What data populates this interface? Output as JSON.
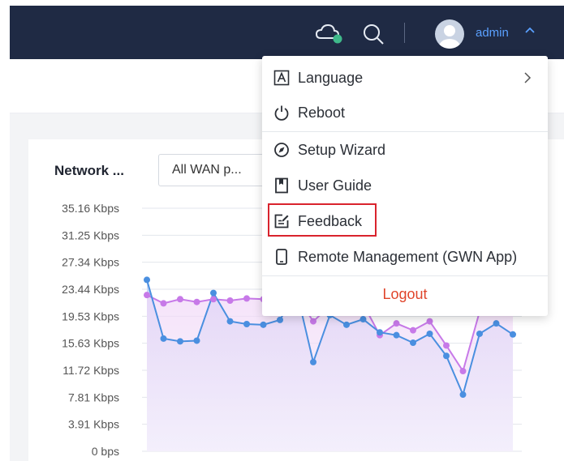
{
  "header": {
    "cloud_icon": "cloud-status-icon",
    "search_icon": "search-icon",
    "user": {
      "name": "admin",
      "avatar_icon": "avatar-icon",
      "chevron_icon": "chevron-up-icon"
    }
  },
  "card": {
    "title": "Network ...",
    "wan_select": {
      "selected": "All WAN p..."
    }
  },
  "user_menu": {
    "items": [
      {
        "label": "Language",
        "icon": "language-icon",
        "has_submenu": true
      },
      {
        "label": "Reboot",
        "icon": "power-icon"
      },
      {
        "label": "Setup Wizard",
        "icon": "compass-icon"
      },
      {
        "label": "User Guide",
        "icon": "book-icon"
      },
      {
        "label": "Feedback",
        "icon": "feedback-edit-icon",
        "highlighted": true
      },
      {
        "label": "Remote Management (GWN App)",
        "icon": "phone-icon"
      }
    ],
    "logout": "Logout"
  },
  "colors": {
    "topbar": "#1f2a44",
    "accent": "#5aa0ff",
    "logout": "#e0452b",
    "highlight_box": "#d9232d",
    "series_upload": "#4a8fe0",
    "series_download": "#c779e8"
  },
  "chart_data": {
    "type": "line",
    "y_unit": "Kbps",
    "y_ticks": [
      "35.16 Kbps",
      "31.25 Kbps",
      "27.34 Kbps",
      "23.44 Kbps",
      "19.53 Kbps",
      "15.63 Kbps",
      "11.72 Kbps",
      "7.81 Kbps",
      "3.91 Kbps",
      "0 bps"
    ],
    "ylim": [
      0,
      35.16
    ],
    "series": [
      {
        "values": [
          24.8,
          16.3,
          15.9,
          16.0,
          22.9,
          18.8,
          18.4,
          18.3,
          19.0,
          23.2,
          12.9,
          19.7,
          18.3,
          19.1,
          17.2,
          16.8,
          15.7,
          17.0,
          13.8,
          8.2,
          17.0,
          18.5,
          16.9
        ]
      },
      {
        "values": [
          22.6,
          21.4,
          22.0,
          21.6,
          22.0,
          21.8,
          22.1,
          22.0,
          22.0,
          22.4,
          18.8,
          21.0,
          20.8,
          21.3,
          16.8,
          18.5,
          17.5,
          18.8,
          15.3,
          11.6,
          20.2,
          20.5,
          21.0
        ]
      }
    ]
  }
}
